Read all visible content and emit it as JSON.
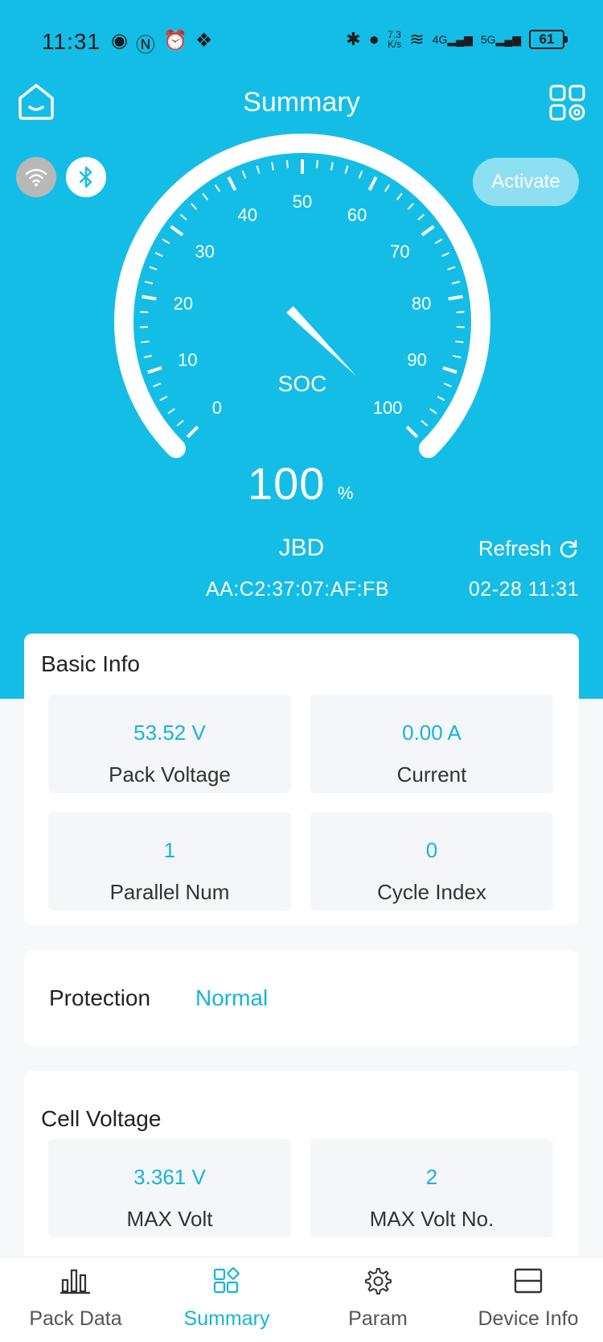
{
  "status_bar": {
    "time": "11:31",
    "left_icons": [
      "eye-icon",
      "nfc-icon",
      "alarm-icon",
      "vpn-icon"
    ],
    "net_speed_value": "7.3",
    "net_speed_unit": "K/s",
    "net1": "4G",
    "net2": "5G",
    "battery": "61"
  },
  "header": {
    "title": "Summary",
    "home_icon": "home-icon",
    "menu_icon": "grid-settings-icon"
  },
  "connection": {
    "wifi_icon": "wifi-icon",
    "bluetooth_icon": "bluetooth-icon",
    "activate_label": "Activate"
  },
  "gauge": {
    "label": "SOC",
    "scale_min": 0,
    "scale_max": 100,
    "ticks": [
      "0",
      "10",
      "20",
      "30",
      "40",
      "50",
      "60",
      "70",
      "80",
      "90",
      "100"
    ],
    "value": "100",
    "value_numeric": 100,
    "unit": "%"
  },
  "device": {
    "name": "JBD",
    "mac": "AA:C2:37:07:AF:FB",
    "refresh_label": "Refresh",
    "timestamp": "02-28 11:31"
  },
  "basic_info": {
    "title": "Basic Info",
    "items": [
      {
        "value": "53.52 V",
        "label": "Pack Voltage"
      },
      {
        "value": "0.00 A",
        "label": "Current"
      },
      {
        "value": "1",
        "label": "Parallel Num"
      },
      {
        "value": "0",
        "label": "Cycle Index"
      }
    ]
  },
  "protection": {
    "label": "Protection",
    "value": "Normal"
  },
  "cell_voltage": {
    "title": "Cell Voltage",
    "items": [
      {
        "value": "3.361 V",
        "label": "MAX Volt"
      },
      {
        "value": "2",
        "label": "MAX Volt No."
      }
    ]
  },
  "nav": {
    "items": [
      {
        "label": "Pack Data",
        "icon": "bar-chart-icon",
        "active": false
      },
      {
        "label": "Summary",
        "icon": "summary-grid-icon",
        "active": true
      },
      {
        "label": "Param",
        "icon": "gear-icon",
        "active": false
      },
      {
        "label": "Device Info",
        "icon": "device-info-icon",
        "active": false
      }
    ]
  },
  "colors": {
    "primary": "#14bde6",
    "accent_text": "#18b4d9",
    "background": "#f7f8fa"
  }
}
